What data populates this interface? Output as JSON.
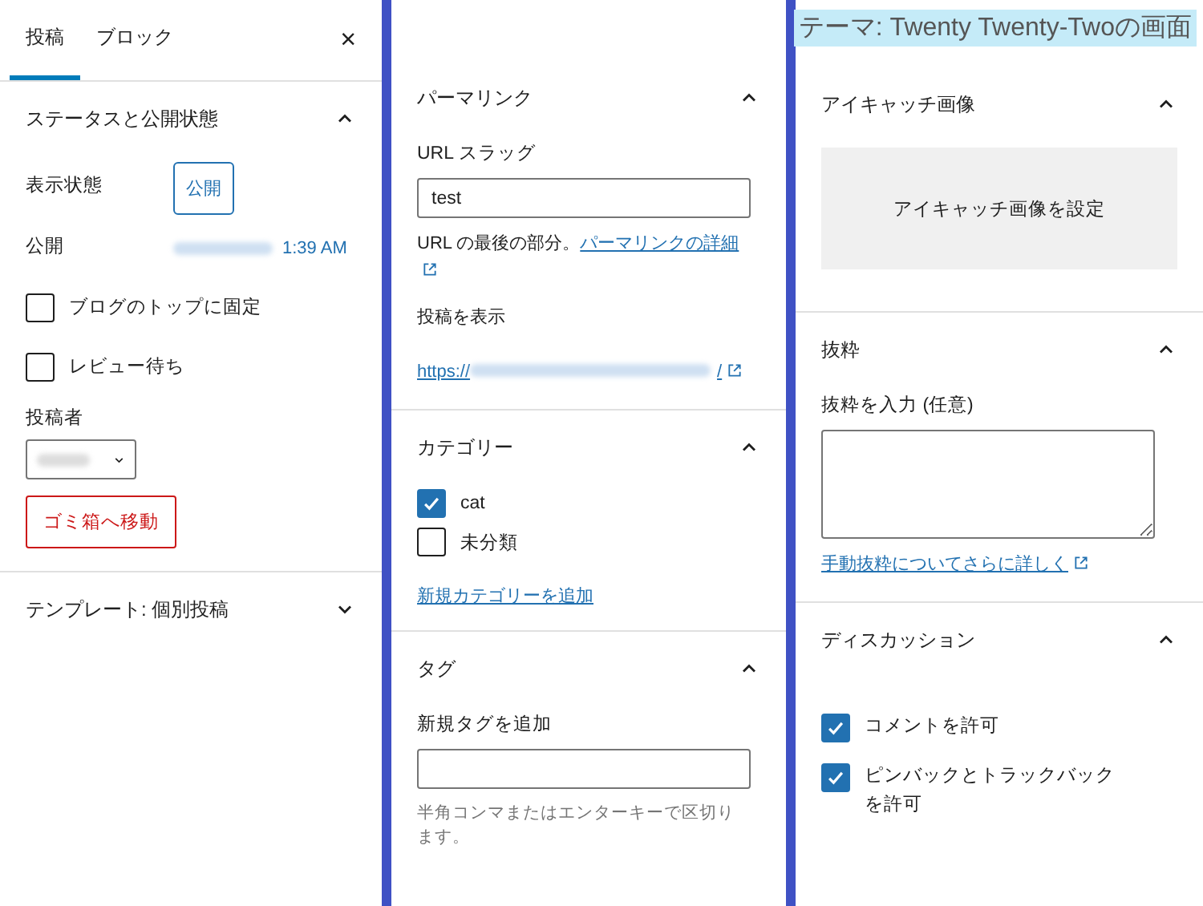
{
  "caption": "テーマ: Twenty Twenty-Twoの画面",
  "panel_1": {
    "tabs": [
      {
        "label": "投稿",
        "selected": true
      },
      {
        "label": "ブロック",
        "selected": false
      }
    ],
    "close": "×",
    "status_section": {
      "title": "ステータスと公開状態",
      "expanded": true,
      "visibility_label": "表示状態",
      "visibility_value": "公開",
      "publish_label": "公開",
      "publish_time": "1:39 AM",
      "options": [
        {
          "label": "ブログのトップに固定",
          "checked": false
        },
        {
          "label": "レビュー待ち",
          "checked": false
        }
      ],
      "author_label": "投稿者",
      "trash_button": "ゴミ箱へ移動"
    },
    "template_section": {
      "title": "テンプレート: 個別投稿",
      "expanded": false
    }
  },
  "panel_2": {
    "permalink": {
      "title": "パーマリンク",
      "expanded": true,
      "slug_label": "URL スラッグ",
      "slug_value": "test",
      "help_text": "URL の最後の部分。",
      "help_link": "パーマリンクの詳細",
      "view_label": "投稿を表示",
      "view_link_start": "https://",
      "view_link_end": "/"
    },
    "categories": {
      "title": "カテゴリー",
      "expanded": true,
      "items": [
        {
          "label": "cat",
          "checked": true
        },
        {
          "label": "未分類",
          "checked": false
        }
      ],
      "add_link": "新規カテゴリーを追加"
    },
    "tags": {
      "title": "タグ",
      "expanded": true,
      "field_label": "新規タグを追加",
      "help_text": "半角コンマまたはエンターキーで区切ります。"
    }
  },
  "panel_3": {
    "featured_image": {
      "title": "アイキャッチ画像",
      "expanded": true,
      "button": "アイキャッチ画像を設定"
    },
    "excerpt": {
      "title": "抜粋",
      "expanded": true,
      "field_label": "抜粋を入力 (任意)",
      "link": "手動抜粋についてさらに詳しく"
    },
    "discussion": {
      "title": "ディスカッション",
      "expanded": true,
      "options": [
        {
          "label": "コメントを許可",
          "checked": true
        },
        {
          "label": "ピンバックとトラックバックを許可",
          "checked": true
        }
      ]
    }
  }
}
